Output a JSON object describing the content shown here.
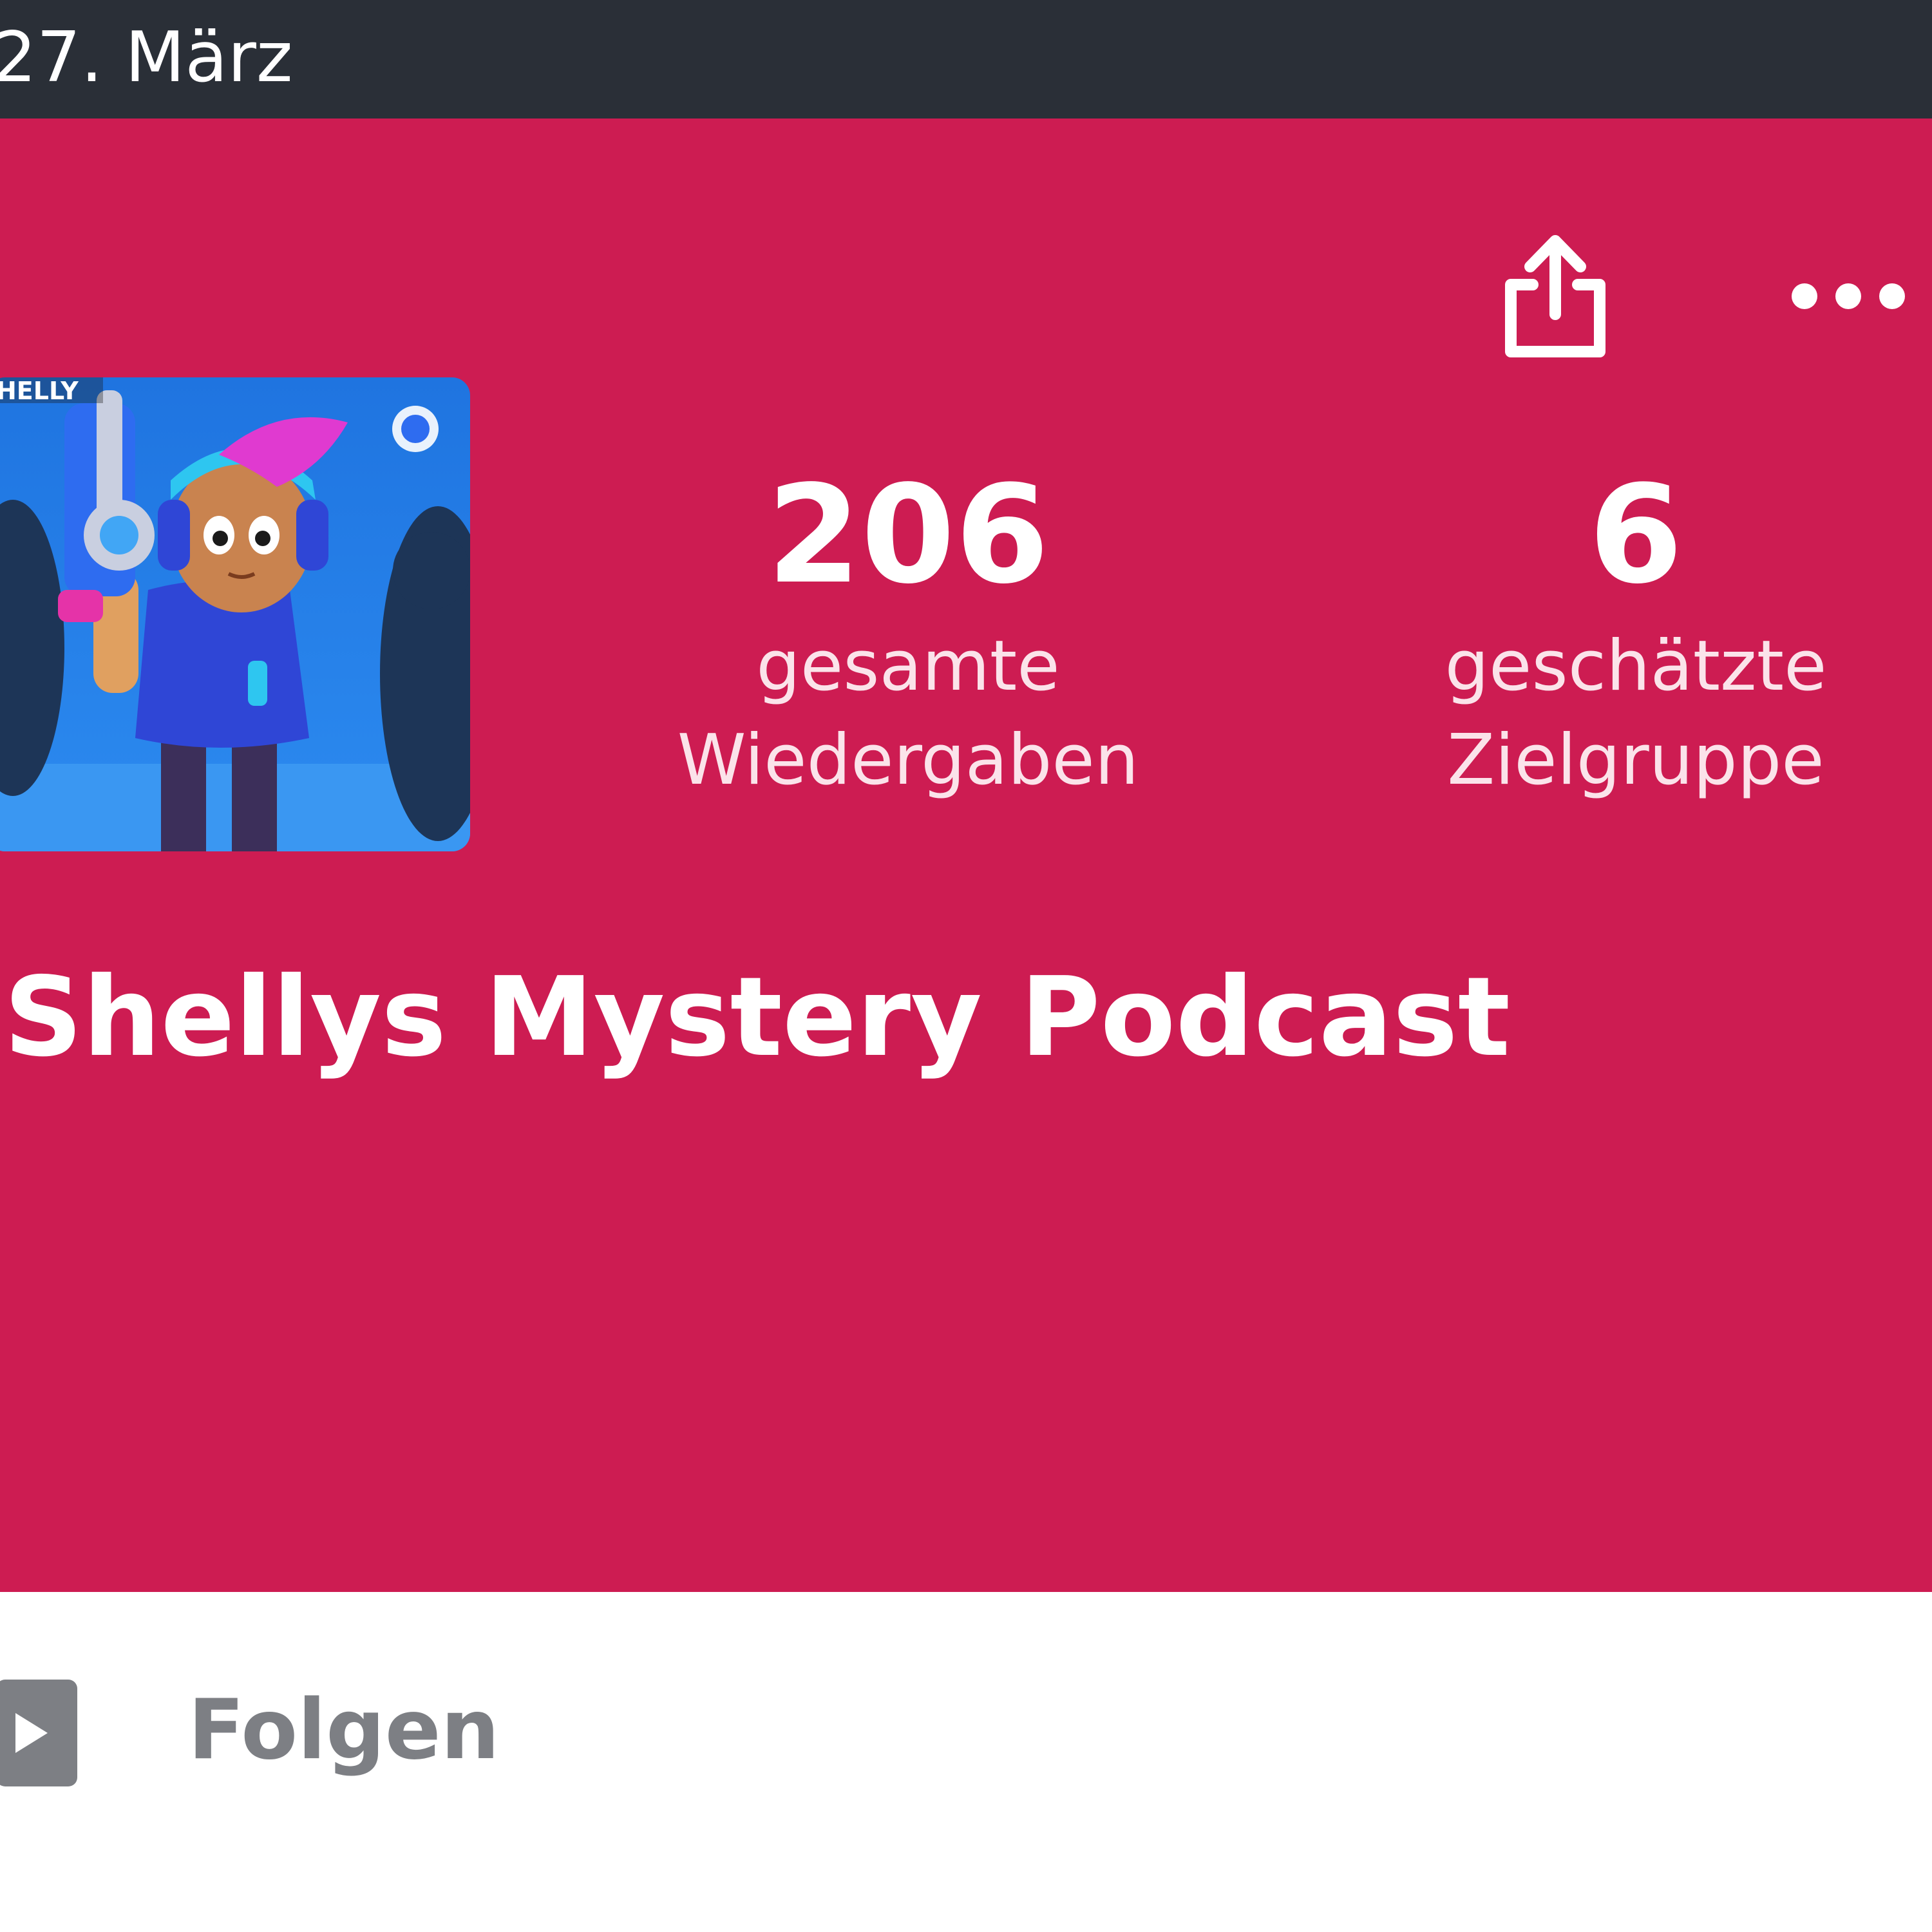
{
  "status_bar": {
    "date": "27. März"
  },
  "header_actions": {
    "share_icon": "share-icon",
    "more_icon": "more-horizontal-icon"
  },
  "podcast": {
    "cover_text": "HELLY",
    "title": "Shellys Mystery Podcast",
    "stats": [
      {
        "value": "206",
        "label_line1": "gesamte",
        "label_line2": "Wiedergaben"
      },
      {
        "value": "6",
        "label_line1": "geschätzte",
        "label_line2": "Zielgruppe"
      }
    ]
  },
  "follow": {
    "label": "Folgen",
    "icon": "play-icon"
  },
  "colors": {
    "hero_background": "#cd1c52",
    "status_bar": "#2a2f37",
    "follow_gray": "#7d7f84"
  }
}
